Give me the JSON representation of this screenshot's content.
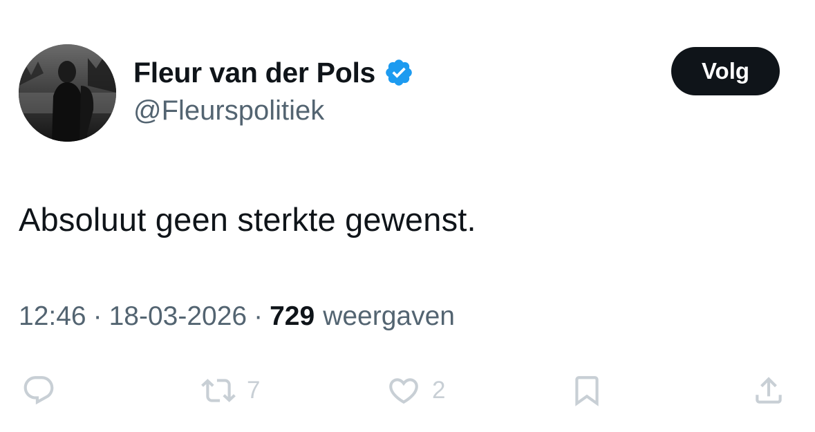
{
  "author": {
    "display_name": "Fleur van der Pols",
    "handle": "@Fleurspolitiek",
    "verified": true,
    "avatar_icon": "profile-photo",
    "verified_color": "#1d9bf0"
  },
  "follow_button": {
    "label": "Volg"
  },
  "tweet": {
    "text": "Absoluut geen sterkte gewenst."
  },
  "meta": {
    "time": "12:46",
    "separator": "·",
    "date": "18-03-2026",
    "views_count": "729",
    "views_label": "weergaven"
  },
  "actions": {
    "reply": {
      "icon": "reply-icon",
      "count": ""
    },
    "retweet": {
      "icon": "retweet-icon",
      "count": "7"
    },
    "like": {
      "icon": "heart-icon",
      "count": "2"
    },
    "bookmark": {
      "icon": "bookmark-icon",
      "count": ""
    },
    "share": {
      "icon": "share-icon",
      "count": ""
    }
  },
  "colors": {
    "text_primary": "#0f1419",
    "text_secondary": "#536471",
    "action_icons": "#c8cfd5",
    "button_bg": "#0f1419"
  }
}
